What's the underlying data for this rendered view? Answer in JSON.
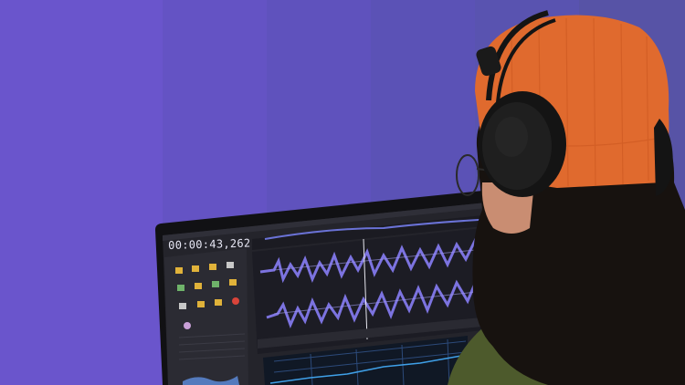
{
  "scene": {
    "background_colors": [
      "#6a55cc",
      "#6453c4",
      "#5f52bd",
      "#5b52b6",
      "#5953b0",
      "#5853aa",
      "#5753a6"
    ],
    "hat_color": "#e06a2e",
    "headphones_color": "#141414",
    "hair_color": "#17120f",
    "jacket_color": "#4d5a2c",
    "screen_bezel_color": "#111114",
    "waveform_color": "#7c73e0"
  },
  "editor": {
    "timecode": "00:00:43,262"
  }
}
